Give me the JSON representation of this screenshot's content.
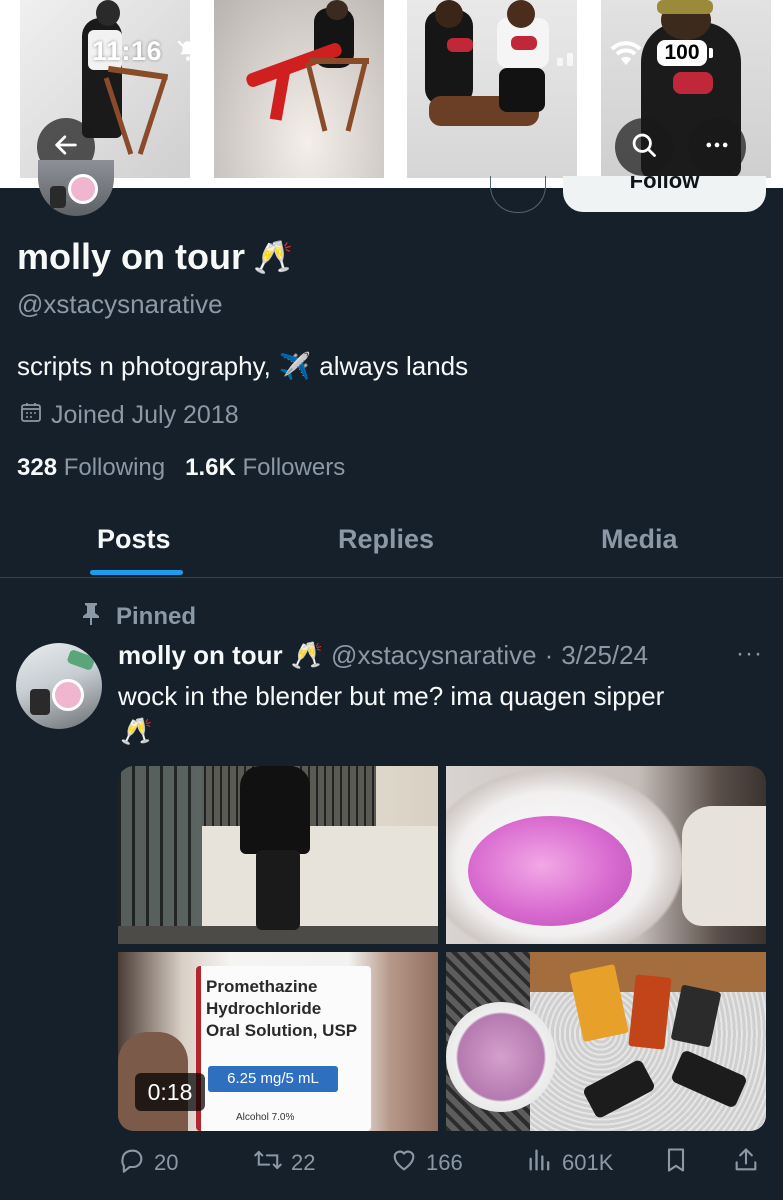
{
  "status_bar": {
    "time": "11:16",
    "battery": "100"
  },
  "profile": {
    "display_name": "molly on tour",
    "name_emoji": "🥂",
    "handle": "@xstacysnarative",
    "bio_text1": "scripts n photography,",
    "bio_emoji": "✈️",
    "bio_text2": "always lands",
    "joined": "Joined July 2018",
    "following_count": "328",
    "following_label": "Following",
    "followers_count": "1.6K",
    "followers_label": "Followers",
    "follow_button": "Follow"
  },
  "tabs": [
    {
      "label": "Posts",
      "active": true
    },
    {
      "label": "Replies",
      "active": false
    },
    {
      "label": "Media",
      "active": false
    }
  ],
  "tweet": {
    "pinned_label": "Pinned",
    "author_name": "molly on tour",
    "author_emoji": "🥂",
    "author_handle": "@xstacysnarative",
    "separator": "·",
    "date": "3/25/24",
    "more": "···",
    "text": "wock in the blender but me? ima quagen sipper",
    "text_emoji": "🥂",
    "video_duration": "0:18",
    "bottle_label": {
      "line1": "Promethazine",
      "line2": "Hydrochloride",
      "line3": "Oral Solution, USP",
      "dose": "6.25 mg/5 mL",
      "alcohol": "Alcohol 7.0%"
    },
    "actions": {
      "replies": "20",
      "reposts": "22",
      "likes": "166",
      "views": "601K"
    }
  },
  "icons": {
    "back": "back-arrow-icon",
    "search": "search-icon",
    "more": "more-icon",
    "calendar": "calendar-icon",
    "pin": "pin-icon",
    "reply": "reply-icon",
    "repost": "repost-icon",
    "like": "like-icon",
    "views": "views-icon",
    "bookmark": "bookmark-icon",
    "share": "share-icon"
  },
  "colors": {
    "background": "#15202b",
    "accent": "#1d9bf0",
    "secondary_text": "#8b98a5"
  }
}
